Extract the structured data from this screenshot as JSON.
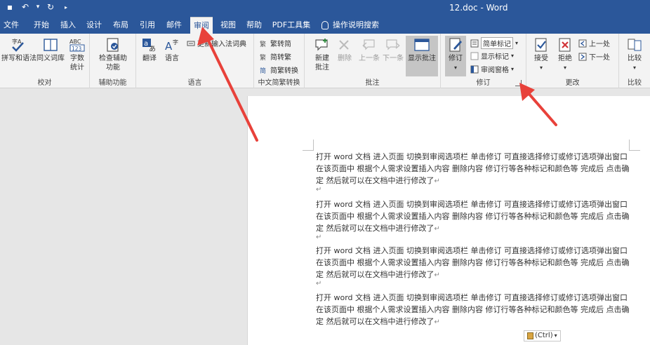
{
  "window": {
    "title": "12.doc - Word"
  },
  "qat": {
    "save": "▪",
    "undo": "↶",
    "undo_more": "▾",
    "redo": "↻",
    "customize": "▸"
  },
  "tabs": [
    {
      "label": "文件"
    },
    {
      "label": "开始"
    },
    {
      "label": "插入"
    },
    {
      "label": "设计"
    },
    {
      "label": "布局"
    },
    {
      "label": "引用"
    },
    {
      "label": "邮件"
    },
    {
      "label": "审阅",
      "active": true
    },
    {
      "label": "视图"
    },
    {
      "label": "帮助"
    },
    {
      "label": "PDF工具集"
    }
  ],
  "tellme": {
    "label": "操作说明搜索"
  },
  "ribbon": {
    "proofing": {
      "spell": "拼写和语法",
      "thesaurus": "同义词库",
      "wordcount": "字数统计",
      "label": "校对"
    },
    "accessibility": {
      "check": "检查辅助功能",
      "label": "辅助功能"
    },
    "language": {
      "translate": "翻译",
      "language": "语言",
      "ime": "更新输入法词典",
      "label": "语言"
    },
    "chinese": {
      "to_simple": "繁转简",
      "to_trad": "简转繁",
      "convert": "简繁转换",
      "label": "中文简繁转换"
    },
    "comments": {
      "new": "新建批注",
      "delete": "删除",
      "prev": "上一条",
      "next": "下一条",
      "show": "显示批注",
      "label": "批注"
    },
    "tracking": {
      "track": "修订",
      "markup": "简单标记",
      "show_markup": "显示标记",
      "pane": "审阅窗格",
      "label": "修订"
    },
    "changes": {
      "accept": "接受",
      "reject": "拒绝",
      "prev": "上一处",
      "next": "下一处",
      "label": "更改"
    },
    "compare": {
      "compare": "比较",
      "label": "比较"
    }
  },
  "document": {
    "paragraphs": [
      "打开 word 文档  进入页面  切换到审阅选项栏  单击修订  可直接选择修订或修订选项弹出窗口  在该页面中  根据个人需求设置插入内容  删除内容  修订行等各种标记和颜色等  完成后  点击确定  然后就可以在文档中进行修改了",
      "打开 word 文档  进入页面  切换到审阅选项栏  单击修订  可直接选择修订或修订选项弹出窗口  在该页面中  根据个人需求设置插入内容  删除内容  修订行等各种标记和颜色等  完成后  点击确定  然后就可以在文档中进行修改了",
      "打开 word 文档  进入页面  切换到审阅选项栏  单击修订  可直接选择修订或修订选项弹出窗口  在该页面中  根据个人需求设置插入内容  删除内容  修订行等各种标记和颜色等  完成后  点击确定  然后就可以在文档中进行修改了",
      "打开 word 文档  进入页面  切换到审阅选项栏  单击修订  可直接选择修订或修订选项弹出窗口  在该页面中  根据个人需求设置插入内容  删除内容  修订行等各种标记和颜色等  完成后  点击确定  然后就可以在文档中进行修改了"
    ],
    "return_mark": "↵"
  },
  "paste_options": {
    "label": "(Ctrl)",
    "caret": "▾"
  },
  "colors": {
    "brand": "#2b579a",
    "arrow": "#e8413a"
  }
}
